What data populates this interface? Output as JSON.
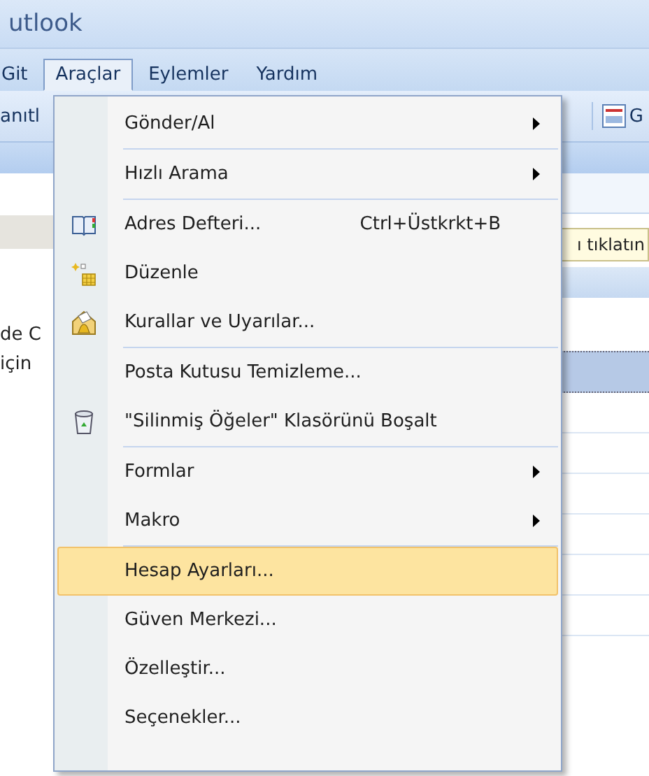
{
  "window": {
    "title": "utlook"
  },
  "menubar": [
    {
      "label": "Git",
      "selected": false
    },
    {
      "label": "Araçlar",
      "selected": true
    },
    {
      "label": "Eylemler",
      "selected": false
    },
    {
      "label": "Yardım",
      "selected": false
    }
  ],
  "toolbar": {
    "left_text": "anıtl",
    "right_text": "G"
  },
  "info_bar": {
    "text": "ı tıklatın"
  },
  "left_pane": [
    "de C",
    "için"
  ],
  "message_list": [
    {
      "selected": true
    },
    {
      "selected": false
    },
    {
      "selected": false
    },
    {
      "selected": false
    },
    {
      "selected": false
    },
    {
      "selected": false
    },
    {
      "selected": false
    }
  ],
  "menu": [
    {
      "kind": "item",
      "label": "Gönder/Al",
      "submenu": true,
      "selected": false
    },
    {
      "kind": "separator"
    },
    {
      "kind": "item",
      "label": "Hızlı Arama",
      "submenu": true,
      "selected": false
    },
    {
      "kind": "separator"
    },
    {
      "kind": "item",
      "label": "Adres Defteri...",
      "shortcut": "Ctrl+Üstkrkt+B",
      "submenu": false,
      "selected": false
    },
    {
      "kind": "item",
      "label": "Düzenle",
      "submenu": false,
      "selected": false
    },
    {
      "kind": "item",
      "label": "Kurallar ve Uyarılar...",
      "submenu": false,
      "selected": false
    },
    {
      "kind": "separator"
    },
    {
      "kind": "item",
      "label": "Posta Kutusu Temizleme...",
      "submenu": false,
      "selected": false
    },
    {
      "kind": "item",
      "label": "\"Silinmiş Öğeler\" Klasörünü Boşalt",
      "submenu": false,
      "selected": false
    },
    {
      "kind": "separator"
    },
    {
      "kind": "item",
      "label": "Formlar",
      "submenu": true,
      "selected": false
    },
    {
      "kind": "item",
      "label": "Makro",
      "submenu": true,
      "selected": false
    },
    {
      "kind": "separator"
    },
    {
      "kind": "item",
      "label": "Hesap Ayarları...",
      "submenu": false,
      "selected": true
    },
    {
      "kind": "item",
      "label": "Güven Merkezi...",
      "submenu": false,
      "selected": false
    },
    {
      "kind": "item",
      "label": "Özelleştir...",
      "submenu": false,
      "selected": false
    },
    {
      "kind": "item",
      "label": "Seçenekler...",
      "submenu": false,
      "selected": false
    }
  ]
}
